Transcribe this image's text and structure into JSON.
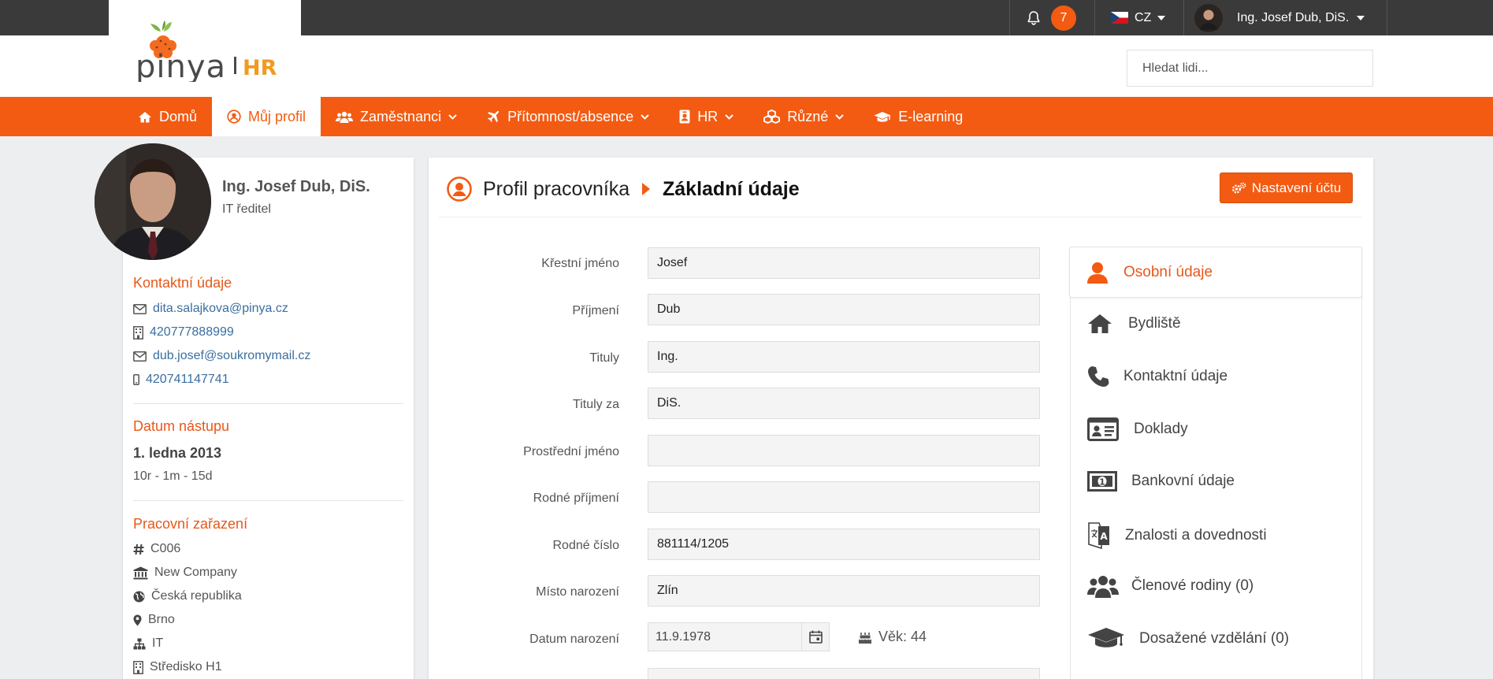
{
  "topbar": {
    "notifications_count": "7",
    "language": "CZ",
    "user_name": "Ing. Josef Dub, DiS."
  },
  "logo": {
    "brand": "pinya",
    "sub": "HR"
  },
  "search": {
    "placeholder": "Hledat lidi..."
  },
  "nav": {
    "items": [
      {
        "label": "Domů",
        "icon": "home-icon"
      },
      {
        "label": "Můj profil",
        "icon": "user-circle-icon",
        "active": true
      },
      {
        "label": "Zaměstnanci",
        "icon": "users-icon",
        "dropdown": true
      },
      {
        "label": "Přítomnost/absence",
        "icon": "plane-icon",
        "dropdown": true
      },
      {
        "label": "HR",
        "icon": "id-badge-icon",
        "dropdown": true
      },
      {
        "label": "Různé",
        "icon": "cubes-icon",
        "dropdown": true
      },
      {
        "label": "E-learning",
        "icon": "graduation-cap-icon"
      }
    ]
  },
  "profile": {
    "name": "Ing. Josef Dub, DiS.",
    "role": "IT ředitel",
    "contact_title": "Kontaktní údaje",
    "contacts": [
      {
        "icon": "envelope-icon",
        "value": "dita.salajkova@pinya.cz"
      },
      {
        "icon": "building-phone-icon",
        "value": "420777888999"
      },
      {
        "icon": "envelope-icon",
        "value": "dub.josef@soukromymail.cz"
      },
      {
        "icon": "mobile-icon",
        "value": "420741147741"
      }
    ],
    "start_title": "Datum nástupu",
    "start_date": "1. ledna 2013",
    "tenure": "10r - 1m - 15d",
    "position_title": "Pracovní zařazení",
    "position": [
      {
        "icon": "hash-icon",
        "value": "C006"
      },
      {
        "icon": "bank-icon",
        "value": "New Company"
      },
      {
        "icon": "globe-icon",
        "value": "Česká republika"
      },
      {
        "icon": "map-marker-icon",
        "value": "Brno"
      },
      {
        "icon": "sitemap-icon",
        "value": "IT"
      },
      {
        "icon": "building-icon",
        "value": "Středisko H1"
      }
    ]
  },
  "main": {
    "title": "Profil pracovníka",
    "subtitle": "Základní údaje",
    "settings_button": "Nastavení účtu",
    "fields": [
      {
        "label": "Křestní jméno",
        "value": "Josef"
      },
      {
        "label": "Příjmení",
        "value": "Dub"
      },
      {
        "label": "Tituly",
        "value": "Ing."
      },
      {
        "label": "Tituly za",
        "value": "DiS."
      },
      {
        "label": "Prostřední jméno",
        "value": ""
      },
      {
        "label": "Rodné příjmení",
        "value": ""
      },
      {
        "label": "Rodné číslo",
        "value": "881114/1205"
      },
      {
        "label": "Místo narození",
        "value": "Zlín"
      }
    ],
    "birth_label": "Datum narození",
    "birth_date": "11.9.1978",
    "age": "Věk: 44"
  },
  "side_menu": {
    "items": [
      {
        "label": "Osobní údaje",
        "icon": "user-icon",
        "active": true
      },
      {
        "label": "Bydliště",
        "icon": "home-icon"
      },
      {
        "label": "Kontaktní údaje",
        "icon": "phone-icon"
      },
      {
        "label": "Doklady",
        "icon": "id-card-icon"
      },
      {
        "label": "Bankovní údaje",
        "icon": "money-bill-icon"
      },
      {
        "label": "Znalosti a dovednosti",
        "icon": "language-icon"
      },
      {
        "label": "Členové rodiny  (0)",
        "icon": "users-icon"
      },
      {
        "label": "Dosažené vzdělání  (0)",
        "icon": "graduation-cap-icon"
      }
    ]
  },
  "colors": {
    "accent": "#f35b12",
    "topbar": "#3a3a3a",
    "link": "#3a6ea0"
  }
}
